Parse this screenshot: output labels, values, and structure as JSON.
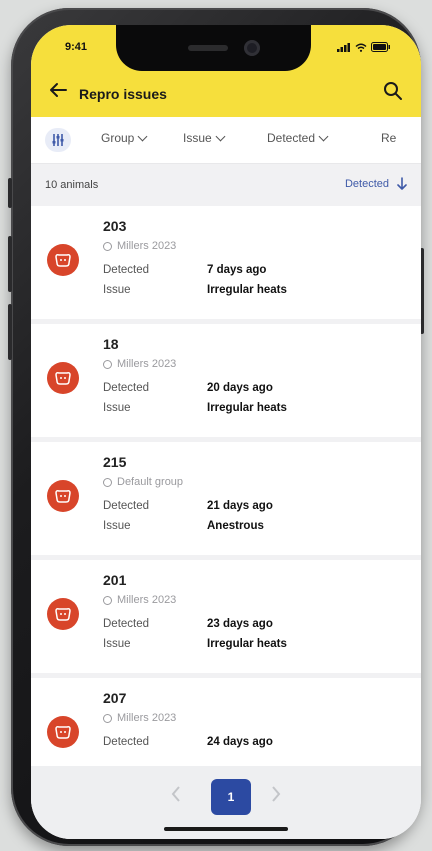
{
  "status": {
    "time": "9:41"
  },
  "header": {
    "title": "Repro issues"
  },
  "filters": [
    {
      "label": "Group"
    },
    {
      "label": "Issue"
    },
    {
      "label": "Detected"
    },
    {
      "label": "Re"
    }
  ],
  "list_header": {
    "count": "10 animals",
    "sort_label": "Detected"
  },
  "field_labels": {
    "detected": "Detected",
    "issue": "Issue"
  },
  "items": [
    {
      "id": "203",
      "group": "Millers 2023",
      "detected": "7 days ago",
      "issue": "Irregular heats"
    },
    {
      "id": "18",
      "group": "Millers 2023",
      "detected": "20 days ago",
      "issue": "Irregular heats"
    },
    {
      "id": "215",
      "group": "Default group",
      "detected": "21 days ago",
      "issue": "Anestrous"
    },
    {
      "id": "201",
      "group": "Millers 2023",
      "detected": "23 days ago",
      "issue": "Irregular heats"
    },
    {
      "id": "207",
      "group": "Millers 2023",
      "detected": "24 days ago",
      "issue": ""
    }
  ],
  "pagination": {
    "current": "1"
  },
  "colors": {
    "appbar": "#f6df3c",
    "accent": "#2c4aa2",
    "avatar": "#d8452a"
  },
  "icons": {
    "back": "arrow-left-icon",
    "search": "search-icon",
    "filter": "sliders-icon",
    "sort": "arrow-down-icon",
    "avatar": "cow-icon"
  }
}
